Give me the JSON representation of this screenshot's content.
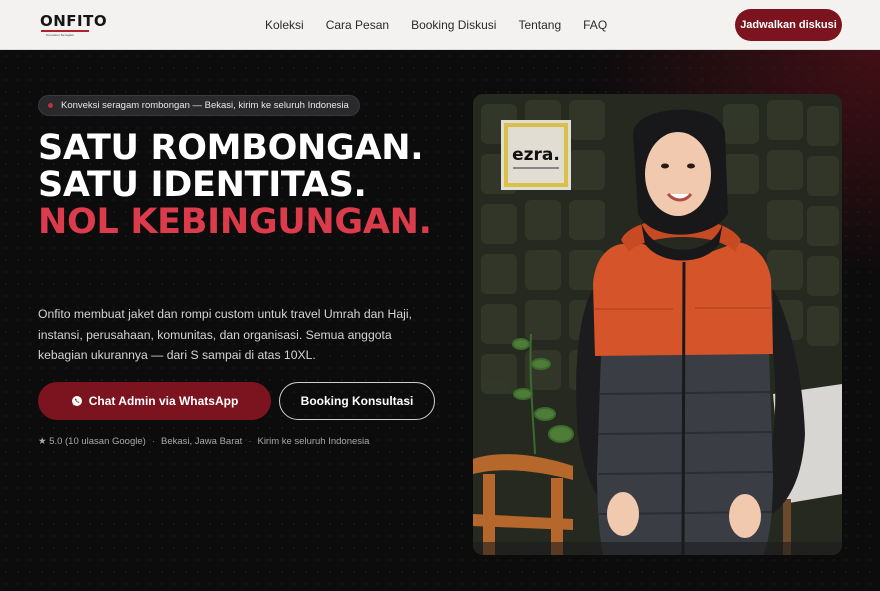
{
  "nav": {
    "logo_text": "ONFITO",
    "logo_tagline": "Konveksi Seragam",
    "links": [
      "Koleksi",
      "Cara Pesan",
      "Booking Diskusi",
      "Tentang",
      "FAQ"
    ],
    "cta_label": "Jadwalkan diskusi"
  },
  "hero": {
    "badge_text": "Konveksi seragam rombongan — Bekasi, kirim ke seluruh Indonesia",
    "headline_line1": "SATU ROMBONGAN.",
    "headline_line2": "SATU IDENTITAS.",
    "headline_line3": "NOL KEBINGUNGAN.",
    "lead": "Onfito membuat jaket dan rompi custom untuk travel Umrah dan Haji, instansi, perusahaan, komunitas, dan organisasi. Semua anggota kebagian ukurannya — dari S sampai di atas 10XL.",
    "primary_button": "Chat Admin via WhatsApp",
    "secondary_button": "Booking Konsultasi",
    "meta": {
      "rating": "★ 5.0 (10 ulasan Google)",
      "location": "Bekasi, Jawa Barat",
      "shipping": "Kirim ke seluruh Indonesia"
    },
    "photo": {
      "sign_text": "ezra.",
      "description_icon": "product-photo"
    }
  },
  "colors": {
    "accent": "#7c1420",
    "headline_red": "#dc3b4b",
    "background": "#0c0c0d",
    "nav_bg": "#f3f2f1"
  }
}
